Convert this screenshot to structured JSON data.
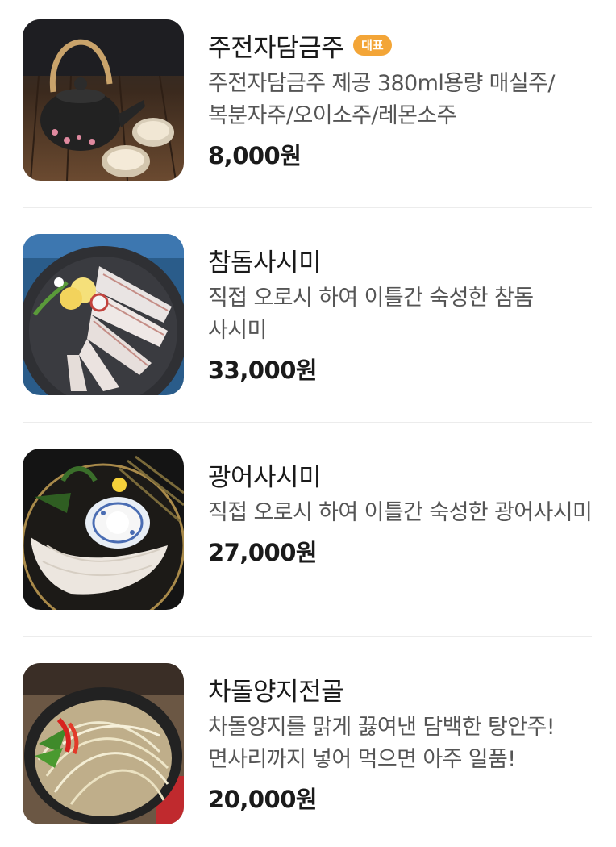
{
  "menu_items": [
    {
      "name": "주전자담금주",
      "badge": "대표",
      "description": "주전자담금주 제공 380ml용량 매실주/복분자주/오이소주/레몬소주",
      "price": "8,000원",
      "image": "teapot-liquor-photo"
    },
    {
      "name": "참돔사시미",
      "badge": "",
      "description": "직접 오로시 하여 이틀간 숙성한 참돔 사시미",
      "price": "33,000원",
      "image": "red-snapper-sashimi-photo"
    },
    {
      "name": "광어사시미",
      "badge": "",
      "description": "직접 오로시 하여 이틀간 숙성한 광어사시미",
      "price": "27,000원",
      "image": "flatfish-sashimi-photo"
    },
    {
      "name": "차돌양지전골",
      "badge": "",
      "description": "차돌양지를 맑게 끓여낸 담백한 탕안주! 면사리까지 넣어 먹으면 아주 일품!",
      "price": "20,000원",
      "image": "beef-brisket-hotpot-photo"
    }
  ],
  "colors": {
    "badge_bg": "#f3a537",
    "divider": "#ececec",
    "text_primary": "#1a1a1a",
    "text_secondary": "#555555"
  }
}
